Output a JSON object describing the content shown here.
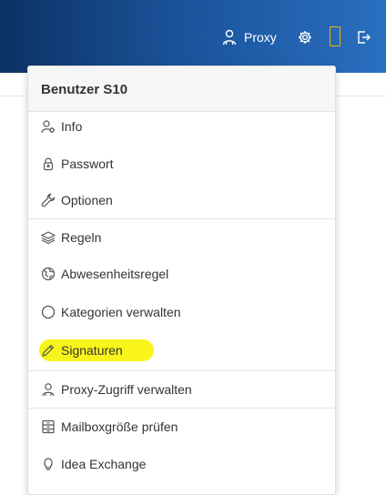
{
  "topbar": {
    "proxy_label": "Proxy",
    "icons": [
      "proxy-user-icon",
      "gear-icon",
      "device-icon",
      "logout-icon"
    ]
  },
  "menu": {
    "title": "Benutzer S10",
    "items": [
      {
        "label": "Info",
        "icon": "user-settings-icon"
      },
      {
        "label": "Passwort",
        "icon": "lock-icon"
      },
      {
        "label": "Optionen",
        "icon": "wrench-icon"
      },
      {
        "label": "Regeln",
        "icon": "layers-icon"
      },
      {
        "label": "Abwesenheitsregel",
        "icon": "globe-icon"
      },
      {
        "label": "Kategorien verwalten",
        "icon": "circle-icon"
      },
      {
        "label": "Signaturen",
        "icon": "pencil-icon",
        "highlighted": true
      },
      {
        "label": "Proxy-Zugriff verwalten",
        "icon": "user-icon"
      },
      {
        "label": "Mailboxgröße prüfen",
        "icon": "mailbox-size-icon"
      },
      {
        "label": "Idea Exchange",
        "icon": "lightbulb-icon"
      }
    ]
  },
  "colors": {
    "topbar_gradient_start": "#0c3264",
    "topbar_gradient_end": "#2a6fc0",
    "highlight": "#f9f51a",
    "device_outline": "#f2b400"
  }
}
